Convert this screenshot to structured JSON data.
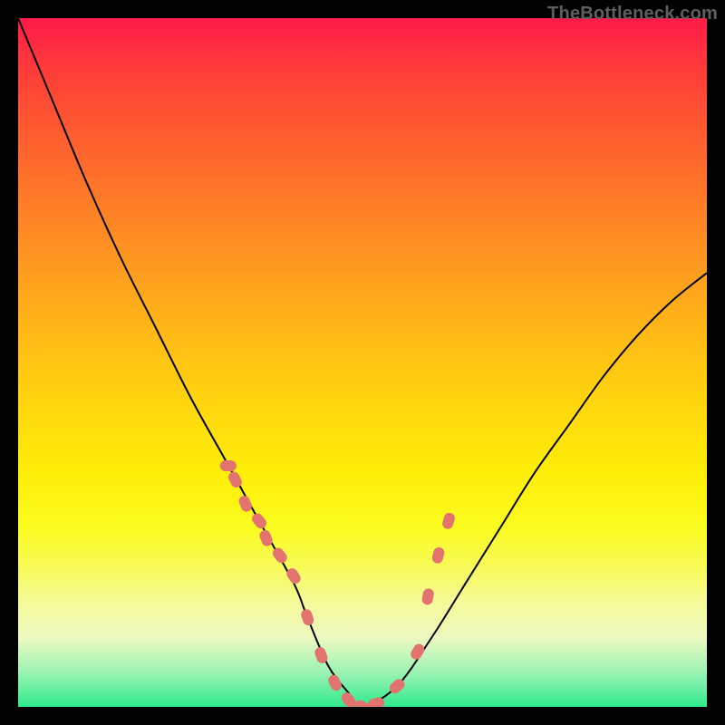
{
  "watermark": "TheBottleneck.com",
  "chart_data": {
    "type": "line",
    "title": "",
    "xlabel": "",
    "ylabel": "",
    "xlim": [
      0,
      100
    ],
    "ylim": [
      0,
      100
    ],
    "series": [
      {
        "name": "curve",
        "x": [
          0,
          5,
          10,
          15,
          20,
          25,
          30,
          35,
          40,
          42,
          45,
          48,
          50,
          55,
          60,
          65,
          70,
          75,
          80,
          85,
          90,
          95,
          100
        ],
        "values": [
          100,
          88,
          76,
          65,
          55,
          45,
          36,
          27,
          18,
          13,
          6,
          2,
          0,
          3,
          10,
          18,
          26,
          34,
          41,
          48,
          54,
          59,
          63
        ]
      },
      {
        "name": "dots",
        "x": [
          30.5,
          31.5,
          33.0,
          35.0,
          36.0,
          38.0,
          40.0,
          42.0,
          44.0,
          46.0,
          48.0,
          50.0,
          52.0,
          55.0,
          58.0,
          59.5,
          61.0,
          62.5
        ],
        "values": [
          35.0,
          33.0,
          29.5,
          27.0,
          24.5,
          22.0,
          19.0,
          13.0,
          7.5,
          3.5,
          1.0,
          0.0,
          0.5,
          3.0,
          8.0,
          16.0,
          22.0,
          27.0
        ]
      }
    ],
    "dot_color": "#e2736e",
    "curve_color": "#000000"
  },
  "bg_gradient_stops": [
    "#ff1a4a",
    "#ffee08",
    "#2fe98c"
  ]
}
